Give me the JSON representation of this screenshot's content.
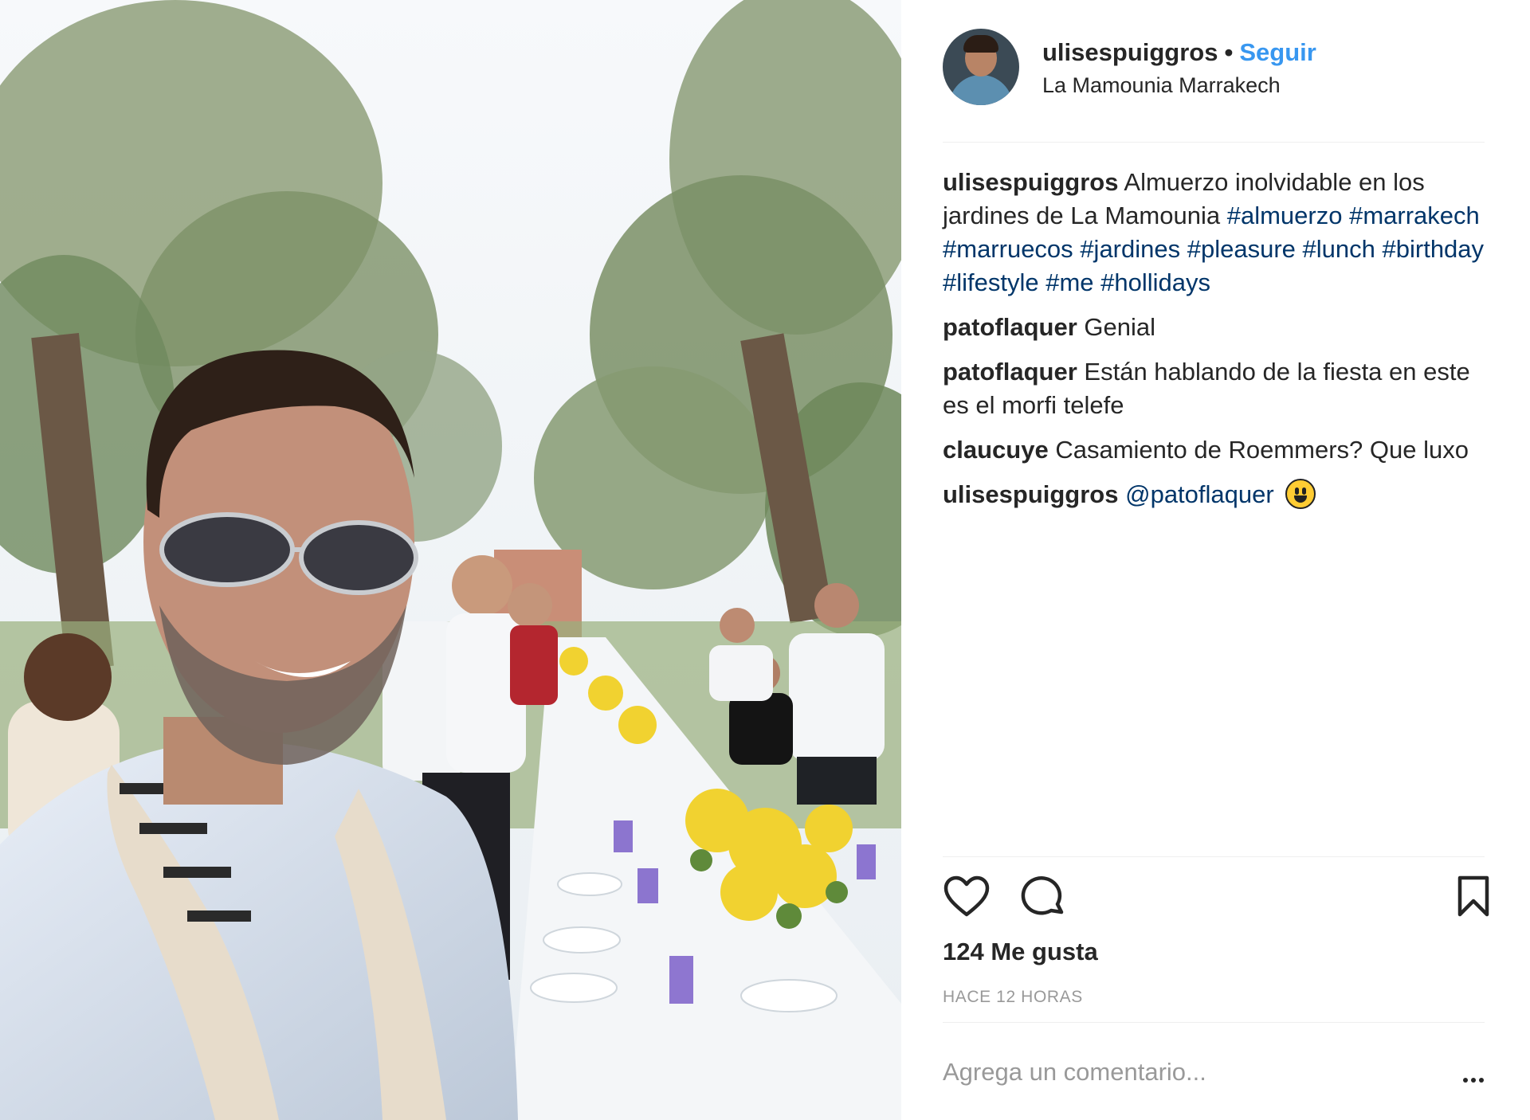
{
  "post": {
    "username": "ulisespuiggros",
    "follow_label": "Seguir",
    "separator": "•",
    "location": "La Mamounia Marrakech",
    "image_alt_icon": "photo"
  },
  "comments": [
    {
      "user": "ulisespuiggros",
      "text": "Almuerzo inolvidable en los jardines de La Mamounia",
      "hashtags": [
        "#almuerzo",
        "#marrakech",
        "#marruecos",
        "#jardines",
        "#pleasure",
        "#lunch",
        "#birthday",
        "#lifestyle",
        "#me",
        "#hollidays"
      ]
    },
    {
      "user": "patoflaquer",
      "text": "Genial"
    },
    {
      "user": "patoflaquer",
      "text": "Están hablando de la fiesta en este es el morfi telefe"
    },
    {
      "user": "claucuye",
      "text": "Casamiento de Roemmers? Que luxo"
    },
    {
      "user": "ulisespuiggros",
      "mention": "@patoflaquer",
      "emoji": "grinning-face-emoji"
    }
  ],
  "actions": {
    "like_icon": "heart-icon",
    "comment_icon": "comment-bubble-icon",
    "save_icon": "bookmark-icon",
    "more_icon": "more-options-icon"
  },
  "likes_text": "124 Me gusta",
  "time_text": "HACE 12 HORAS",
  "add_comment_placeholder": "Agrega un comentario...",
  "colors": {
    "link_blue": "#3897f0",
    "hashtag_blue": "#003569",
    "text": "#262626",
    "muted": "#999999",
    "divider": "#efefef"
  }
}
